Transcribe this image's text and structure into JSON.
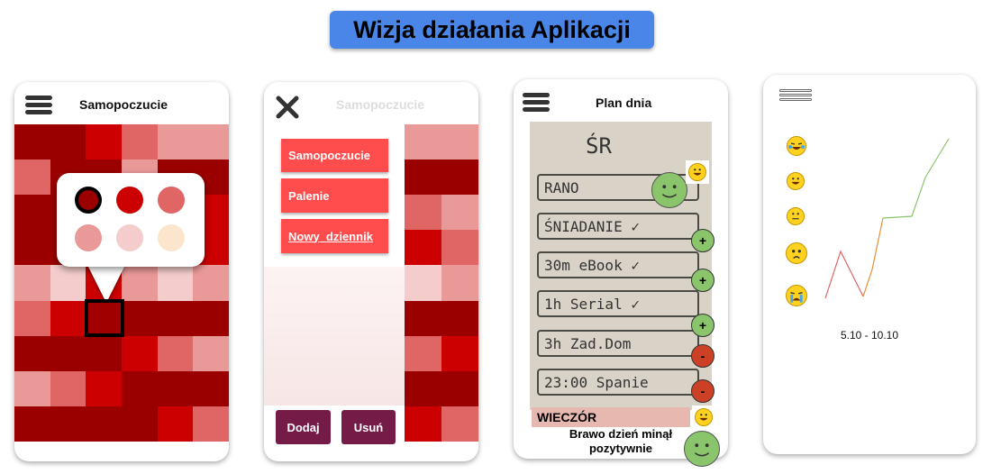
{
  "header": {
    "title": "Wizja działania Aplikacji"
  },
  "colors": {
    "accent_blue": "#4a86e8",
    "menu_red": "#ff4d4d",
    "button_dark": "#741b47",
    "positive_green": "#8ac46b",
    "negative_red": "#cc4125"
  },
  "screen1": {
    "title": "Samopoczucie",
    "palette": [
      "#9b0000",
      "#cc0000",
      "#e06666",
      "#ea9999",
      "#f4cccc",
      "#fce5cd"
    ]
  },
  "screen2": {
    "title": "Samopoczucie",
    "menu_items": [
      "Samopoczucie",
      "Palenie",
      "Nowy_dziennik"
    ],
    "add_label": "Dodaj",
    "remove_label": "Usuń"
  },
  "screen3": {
    "title": "Plan dnia",
    "day_label": "ŚR",
    "rows": [
      "RANO",
      "ŚNIADANIE ✓",
      "30m eBook ✓",
      "1h Serial ✓",
      "3h Zad.Dom",
      "23:00 Spanie"
    ],
    "buttons": [
      "+",
      "+",
      "+",
      "-",
      "-"
    ],
    "evening_label": "WIECZÓR",
    "message_line1": "Brawo dzień minął",
    "message_line2": "pozytywnie"
  },
  "screen4": {
    "date_range": "5.10 - 10.10",
    "mood_icons": [
      "happy-tears-emoji-icon",
      "grin-emoji-icon",
      "neutral-emoji-icon",
      "worried-emoji-icon",
      "crying-emoji-icon"
    ]
  }
}
